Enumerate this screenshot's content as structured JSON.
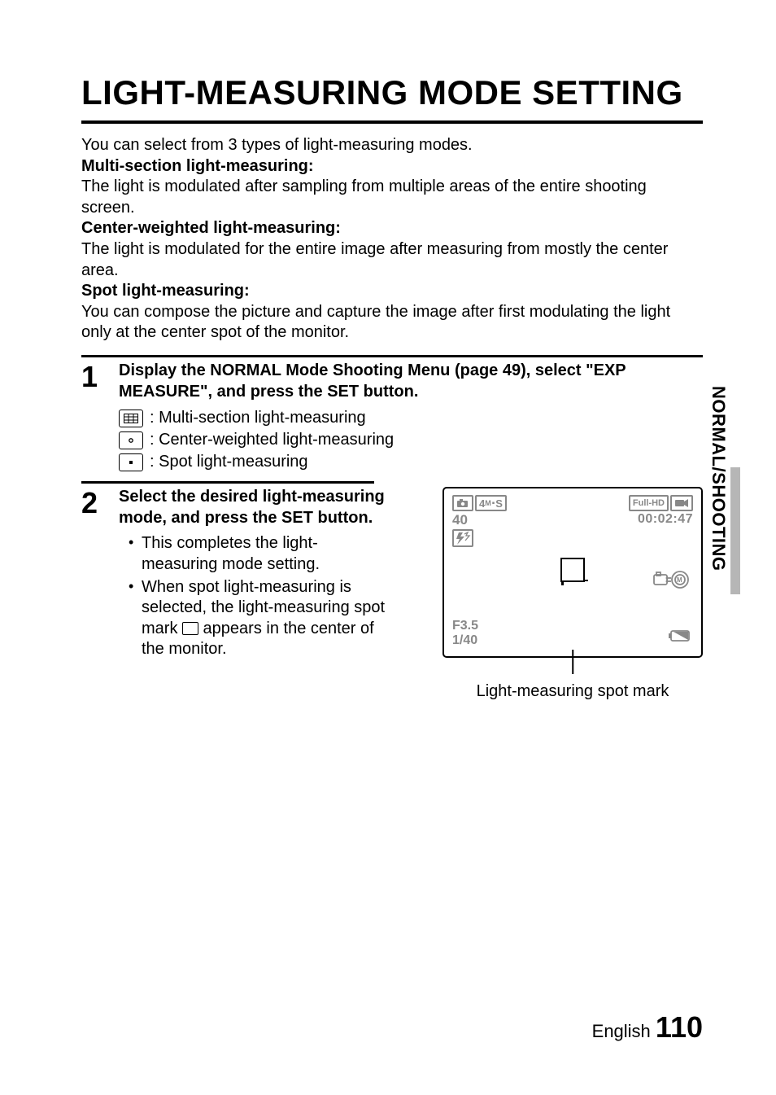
{
  "side_tab": "NORMAL/SHOOTING",
  "title": "LIGHT-MEASURING MODE SETTING",
  "intro": {
    "lead": "You can select from 3 types of light-measuring modes.",
    "modes": [
      {
        "name": "Multi-section light-measuring:",
        "desc": "The light is modulated after sampling from multiple areas of the entire shooting screen."
      },
      {
        "name": "Center-weighted light-measuring:",
        "desc": "The light is modulated for the entire image after measuring from mostly the center area."
      },
      {
        "name": "Spot light-measuring:",
        "desc": "You can compose the picture and capture the image after first modulating the light only at the center spot of the monitor."
      }
    ]
  },
  "step1": {
    "num": "1",
    "instr": "Display the NORMAL Mode Shooting Menu (page 49), select \"EXP MEASURE\", and press the SET button.",
    "items": [
      {
        "label": ": Multi-section light-measuring"
      },
      {
        "label": ": Center-weighted light-measuring"
      },
      {
        "label": ": Spot light-measuring"
      }
    ]
  },
  "step2": {
    "num": "2",
    "instr": "Select the desired light-measuring mode, and press the SET button.",
    "bullet1": "This completes the light-measuring mode setting.",
    "bullet2a": "When spot light-measuring is selected, the light-measuring spot mark ",
    "bullet2b": " appears in the center of the monitor."
  },
  "monitor": {
    "photo_size": "4",
    "photo_unit": "M",
    "photo_suffix": "S",
    "remaining": "40",
    "video_mode": "Full-HD",
    "timecode": "00:02:47",
    "aperture": "F3.5",
    "shutter": "1/40"
  },
  "caption": "Light-measuring spot mark",
  "footer": {
    "lang": "English",
    "page": "110"
  }
}
